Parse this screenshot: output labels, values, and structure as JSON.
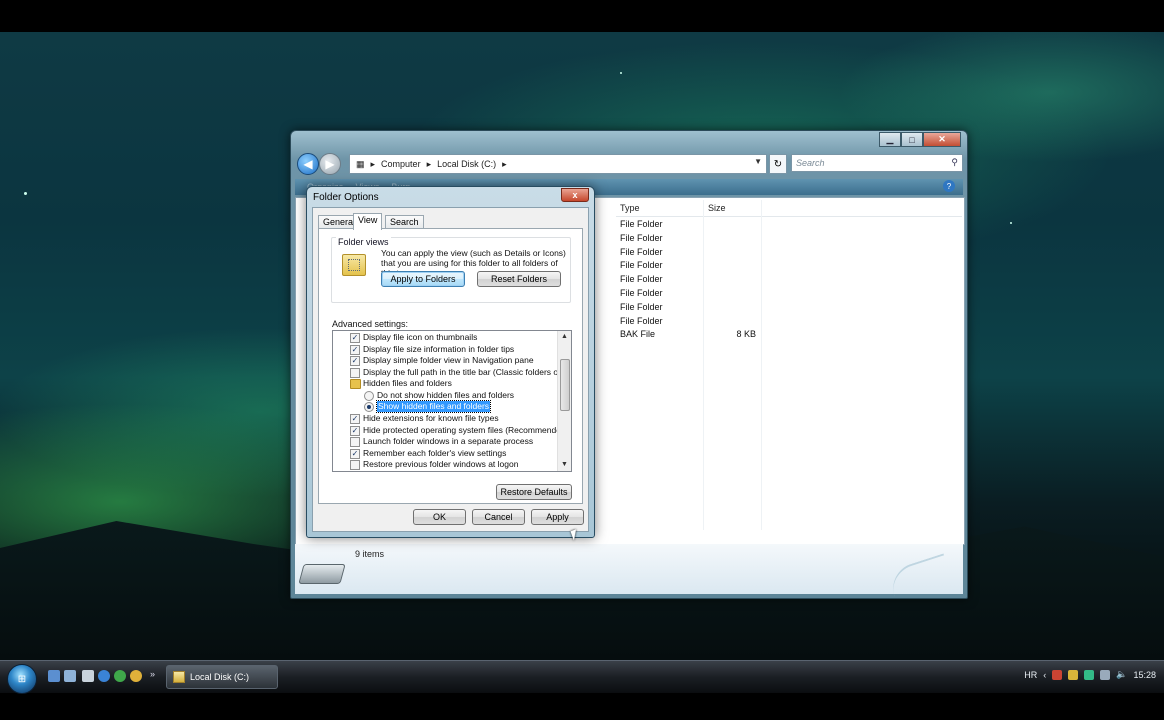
{
  "explorer": {
    "address": [
      "Computer",
      "Local Disk (C:)"
    ],
    "search_placeholder": "Search",
    "toolbar": [
      "Organize",
      "Views",
      "Burn"
    ],
    "columns": [
      "Type",
      "Size"
    ],
    "files": [
      {
        "type": "File Folder",
        "size": ""
      },
      {
        "type": "File Folder",
        "size": ""
      },
      {
        "type": "File Folder",
        "size": ""
      },
      {
        "type": "File Folder",
        "size": ""
      },
      {
        "type": "File Folder",
        "size": ""
      },
      {
        "type": "File Folder",
        "size": ""
      },
      {
        "type": "File Folder",
        "size": ""
      },
      {
        "type": "File Folder",
        "size": ""
      },
      {
        "type": "BAK File",
        "size": "8 KB"
      }
    ],
    "item_count": "9 items"
  },
  "dialog": {
    "title": "Folder Options",
    "close": "x",
    "tabs": [
      "General",
      "View",
      "Search"
    ],
    "active_tab": "View",
    "folder_views": {
      "legend": "Folder views",
      "description": "You can apply the view (such as Details or Icons) that you are using for this folder to all folders of this type.",
      "apply_label": "Apply to Folders",
      "reset_label": "Reset Folders"
    },
    "advanced_label": "Advanced settings:",
    "settings": [
      {
        "kind": "checkbox",
        "label": "Display file icon on thumbnails",
        "checked": true
      },
      {
        "kind": "checkbox",
        "label": "Display file size information in folder tips",
        "checked": true
      },
      {
        "kind": "checkbox",
        "label": "Display simple folder view in Navigation pane",
        "checked": true
      },
      {
        "kind": "checkbox",
        "label": "Display the full path in the title bar (Classic folders only)",
        "checked": false
      },
      {
        "kind": "folder",
        "label": "Hidden files and folders"
      },
      {
        "kind": "radio",
        "label": "Do not show hidden files and folders",
        "checked": false
      },
      {
        "kind": "radio",
        "label": "Show hidden files and folders",
        "checked": true,
        "selected": true
      },
      {
        "kind": "checkbox",
        "label": "Hide extensions for known file types",
        "checked": true
      },
      {
        "kind": "checkbox",
        "label": "Hide protected operating system files (Recommended)",
        "checked": true
      },
      {
        "kind": "checkbox",
        "label": "Launch folder windows in a separate process",
        "checked": false
      },
      {
        "kind": "checkbox",
        "label": "Remember each folder's view settings",
        "checked": true
      },
      {
        "kind": "checkbox",
        "label": "Restore previous folder windows at logon",
        "checked": false
      }
    ],
    "restore_defaults_label": "Restore Defaults",
    "ok_label": "OK",
    "cancel_label": "Cancel",
    "apply_label": "Apply"
  },
  "taskbar": {
    "window_button": "Local Disk (C:)",
    "language": "HR",
    "clock": "15:28"
  }
}
